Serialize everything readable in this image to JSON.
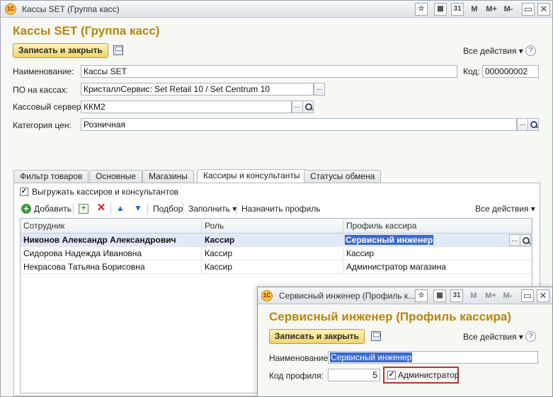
{
  "main_window": {
    "app_logo": "1С",
    "title": "Кассы SET (Группа касс)",
    "titlebar_buttons": [
      "M",
      "M+",
      "M-"
    ],
    "form_title": "Кассы SET (Группа касс)",
    "save_close_label": "Записать и закрыть",
    "all_actions_label": "Все действия",
    "help_label": "?",
    "fields": {
      "name_label": "Наименование:",
      "name_value": "Кассы SET",
      "code_label": "Код:",
      "code_value": "000000002",
      "pos_software_label": "ПО на кассах:",
      "pos_software_value": "КристаллСервис: Set Retail 10 / Set Centrum 10",
      "cash_server_label": "Кассовый сервер:",
      "cash_server_value": "ККМ2",
      "price_category_label": "Категория цен:",
      "price_category_value": "Розничная"
    },
    "tabs": [
      {
        "label": "Фильтр товаров"
      },
      {
        "label": "Основные"
      },
      {
        "label": "Магазины"
      },
      {
        "label": "Кассиры и консультанты",
        "active": true
      },
      {
        "label": "Статусы обмена"
      }
    ],
    "export_checkbox_label": "Выгружать кассиров и консультантов",
    "toolbar": {
      "add_label": "Добавить",
      "pick_label": "Подбор",
      "fill_label": "Заполнить",
      "assign_profile_label": "Назначить профиль",
      "all_actions_label": "Все действия"
    },
    "table": {
      "columns": [
        "Сотрудник",
        "Роль",
        "Профиль кассира"
      ],
      "rows": [
        {
          "employee": "Никонов Александр Александрович",
          "role": "Кассир",
          "profile": "Сервисный инженер",
          "selected": true
        },
        {
          "employee": "Сидорова Надежда Ивановна",
          "role": "Кассир",
          "profile": "Кассир"
        },
        {
          "employee": "Некрасова Татьяна Борисовна",
          "role": "Кассир",
          "profile": "Администратор магазина"
        }
      ]
    }
  },
  "sub_window": {
    "title": "Сервисный инженер (Профиль к...",
    "titlebar_buttons": [
      "M",
      "M+",
      "M-"
    ],
    "form_title": "Сервисный инженер (Профиль кассира)",
    "save_close_label": "Записать и закрыть",
    "all_actions_label": "Все действия",
    "name_label": "Наименование:",
    "name_value": "Сервисный инженер",
    "profile_code_label": "Код профиля:",
    "profile_code_value": "5",
    "admin_checkbox_label": "Администратор",
    "admin_checked": true
  },
  "colors": {
    "form_title": "#b8860b",
    "selection": "#3a6ad0",
    "highlight_box": "#c03030"
  }
}
